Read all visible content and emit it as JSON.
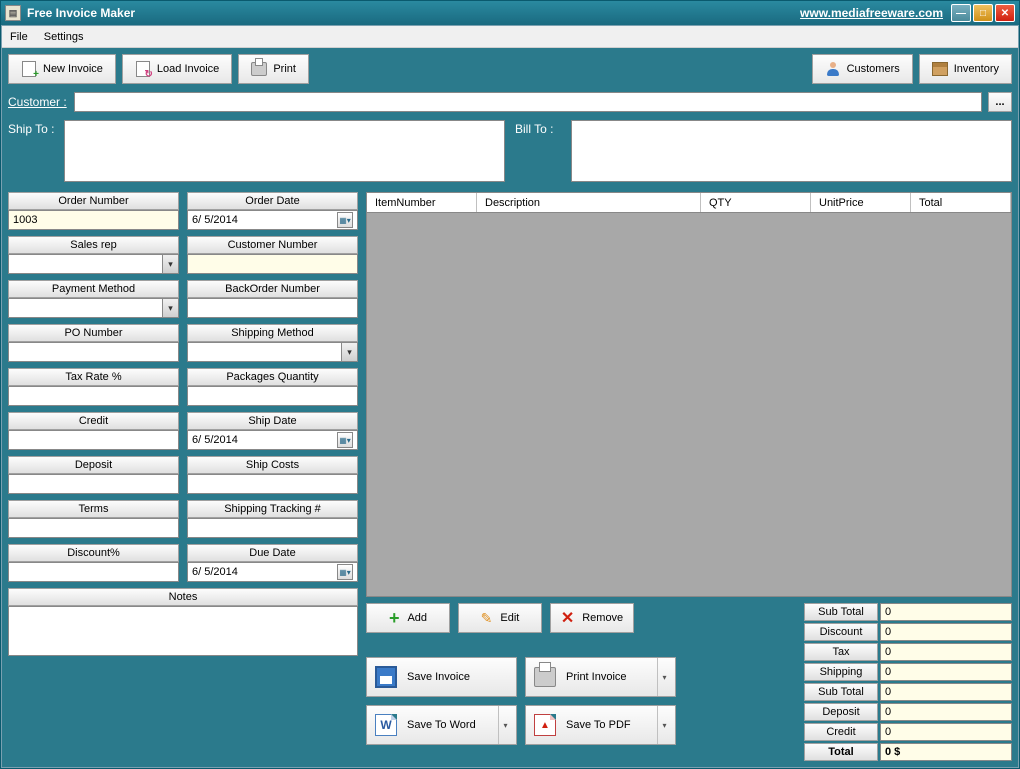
{
  "titlebar": {
    "title": "Free Invoice Maker",
    "link": "www.mediafreeware.com"
  },
  "menu": {
    "file": "File",
    "settings": "Settings"
  },
  "toolbar": {
    "new_invoice": "New Invoice",
    "load_invoice": "Load Invoice",
    "print": "Print",
    "customers": "Customers",
    "inventory": "Inventory"
  },
  "labels": {
    "customer": "Customer :",
    "ship_to": "Ship To :",
    "bill_to": "Bill To :",
    "ellipsis": "..."
  },
  "left_fields": {
    "order_number": {
      "label": "Order Number",
      "value": "1003"
    },
    "sales_rep": {
      "label": "Sales rep",
      "value": ""
    },
    "payment_method": {
      "label": "Payment Method",
      "value": ""
    },
    "po_number": {
      "label": "PO Number",
      "value": ""
    },
    "tax_rate": {
      "label": "Tax Rate %",
      "value": ""
    },
    "credit": {
      "label": "Credit",
      "value": ""
    },
    "deposit": {
      "label": "Deposit",
      "value": ""
    },
    "terms": {
      "label": "Terms",
      "value": ""
    },
    "discount_pct": {
      "label": "Discount%",
      "value": ""
    }
  },
  "right_fields": {
    "order_date": {
      "label": "Order Date",
      "value": "6/  5/2014"
    },
    "customer_number": {
      "label": "Customer Number",
      "value": ""
    },
    "backorder_number": {
      "label": "BackOrder Number",
      "value": ""
    },
    "shipping_method": {
      "label": "Shipping Method",
      "value": ""
    },
    "packages_qty": {
      "label": "Packages Quantity",
      "value": ""
    },
    "ship_date": {
      "label": "Ship Date",
      "value": "6/  5/2014"
    },
    "ship_costs": {
      "label": "Ship Costs",
      "value": ""
    },
    "shipping_tracking": {
      "label": "Shipping Tracking #",
      "value": ""
    },
    "due_date": {
      "label": "Due Date",
      "value": "6/  5/2014"
    }
  },
  "notes_label": "Notes",
  "grid": {
    "cols": {
      "item": "ItemNumber",
      "desc": "Description",
      "qty": "QTY",
      "unit": "UnitPrice",
      "total": "Total"
    }
  },
  "grid_buttons": {
    "add": "Add",
    "edit": "Edit",
    "remove": "Remove"
  },
  "save_buttons": {
    "save_invoice": "Save Invoice",
    "print_invoice": "Print Invoice",
    "save_word": "Save To Word",
    "save_pdf": "Save To PDF"
  },
  "totals": {
    "sub_total1": {
      "label": "Sub Total",
      "value": "0"
    },
    "discount": {
      "label": "Discount",
      "value": "0"
    },
    "tax": {
      "label": "Tax",
      "value": "0"
    },
    "shipping": {
      "label": "Shipping",
      "value": "0"
    },
    "sub_total2": {
      "label": "Sub Total",
      "value": "0"
    },
    "deposit": {
      "label": "Deposit",
      "value": "0"
    },
    "credit": {
      "label": "Credit",
      "value": "0"
    },
    "total": {
      "label": "Total",
      "value": "0 $"
    }
  }
}
